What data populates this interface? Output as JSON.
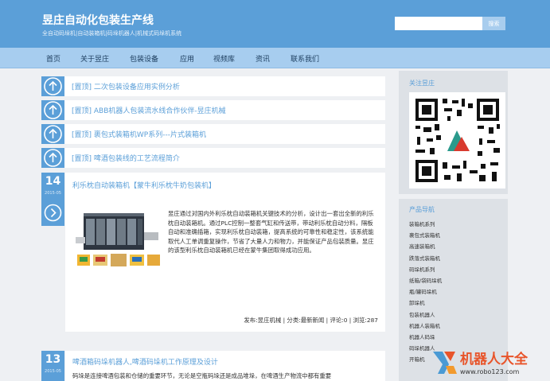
{
  "header": {
    "title": "昱庄自动化包装生产线",
    "subtitle": "全自动码垛机|自动装箱机|码垛机器人|机械式码垛机系统",
    "search_placeholder": "",
    "search_button": "搜索"
  },
  "nav": [
    "首页",
    "关于昱庄",
    "包装设备",
    "应用",
    "视频库",
    "资讯",
    "联系我们"
  ],
  "sticky_posts": [
    "[置顶] 二次包装设备应用实例分析",
    "[置顶] ABB机器人包装流水线合作伙伴-昱庄机械",
    "[置顶] 裹包式装箱机WP系列---片式装箱机",
    "[置顶] 啤酒包装线的工艺流程简介"
  ],
  "posts": [
    {
      "day": "14",
      "ym": "2015-05",
      "title": "利乐枕自动装箱机【蒙牛利乐枕牛奶包装机】",
      "body": "昱庄通过对国内外利乐枕自动装箱机关键技术的分析，设计出一套出全新的利乐枕自动装箱机。通过PLC控制一整套气缸和传送带，带动利乐枕自动分料，隔板自动和准确插箱，实现利乐枕自动装箱，提高系统的可靠性和稳定性，该系统能取代人工单调重复操作，节省了大量人力和物力，并能保证产品包装质量。昱庄的该型利乐枕自动装箱机已经在蒙牛集团取得成功应用。",
      "meta": "发布:昱庄机械 | 分类:最新新闻 | 评论:0 | 浏览:287"
    },
    {
      "day": "13",
      "ym": "2015-05",
      "title": "啤酒箱码垛机器人,啤酒码垛机工作原理及设计",
      "body": "码垛是连接啤酒包装和仓储的重要环节，无论是空瓶码垛还是成品堆垛，在啤酒生产物流中都有重要"
    }
  ],
  "sidebar": {
    "follow_title": "关注昱庄",
    "nav_title": "产品导航",
    "links": [
      "装箱机系列",
      "裹包式装箱机",
      "高速装箱机",
      "跌落式装箱机",
      "码垛机系列",
      "纸箱/袋码垛机",
      "瓶/罐码垛机",
      "卸垛机",
      "包装机器人",
      "机器人装箱机",
      "机器人码垛",
      "码垛机器人",
      "开箱机"
    ]
  },
  "watermark": {
    "text": "机器人大全",
    "url": "www.robo123.com"
  }
}
